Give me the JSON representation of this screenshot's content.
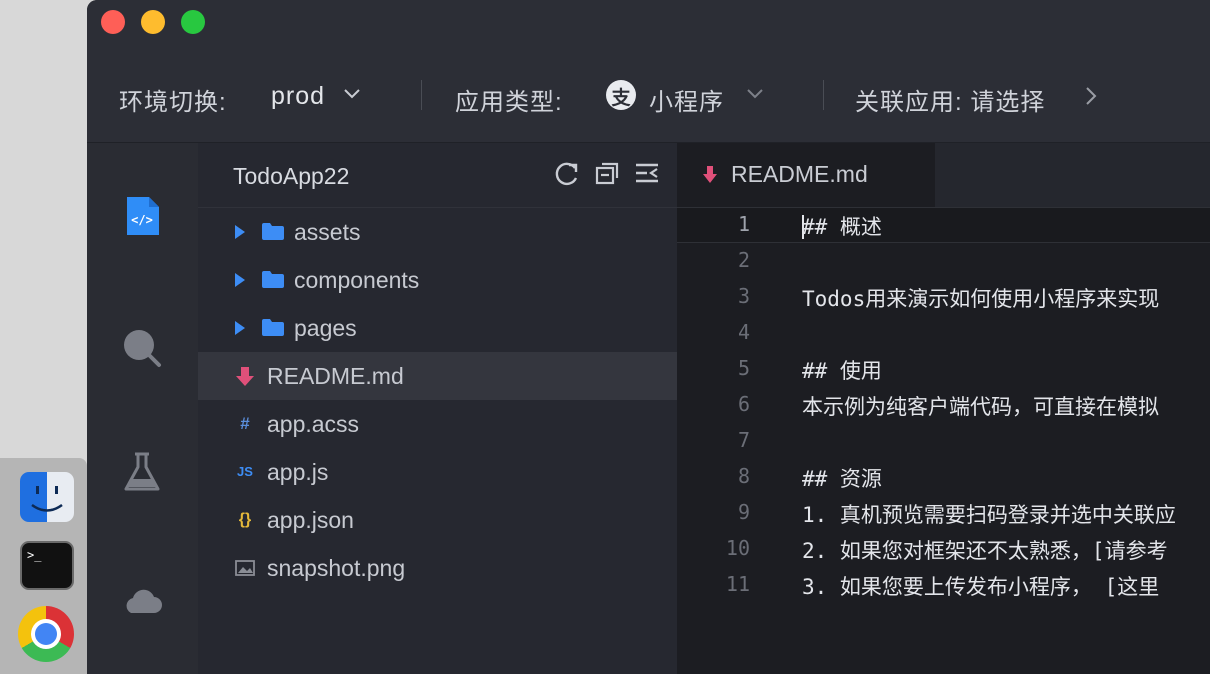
{
  "toolbar": {
    "env_label": "环境切换:",
    "env_value": "prod",
    "app_type_label": "应用类型:",
    "app_type_logo": "支",
    "app_type_value": "小程序",
    "link_label": "关联应用: 请选择"
  },
  "activity_bar": {
    "items": [
      {
        "icon": "code-file-icon",
        "active": true
      },
      {
        "icon": "search-icon",
        "active": false
      },
      {
        "icon": "flask-icon",
        "active": false
      },
      {
        "icon": "cloud-icon",
        "active": false
      }
    ]
  },
  "explorer": {
    "project": "TodoApp22",
    "tools": [
      "refresh-icon",
      "collapse-all-icon",
      "more-icon"
    ],
    "items": [
      {
        "type": "folder",
        "label": "assets"
      },
      {
        "type": "folder",
        "label": "components"
      },
      {
        "type": "folder",
        "label": "pages"
      },
      {
        "type": "markdown",
        "label": "README.md",
        "selected": true
      },
      {
        "type": "acss",
        "label": "app.acss",
        "icon_text": "#"
      },
      {
        "type": "js",
        "label": "app.js",
        "icon_text": "JS"
      },
      {
        "type": "json",
        "label": "app.json",
        "icon_text": "{}"
      },
      {
        "type": "image",
        "label": "snapshot.png"
      }
    ]
  },
  "editor": {
    "tab": {
      "label": "README.md"
    },
    "lines": [
      {
        "n": "1",
        "text": "## 概述"
      },
      {
        "n": "2",
        "text": ""
      },
      {
        "n": "3",
        "text": "Todos用来演示如何使用小程序来实现"
      },
      {
        "n": "4",
        "text": ""
      },
      {
        "n": "5",
        "text": "## 使用"
      },
      {
        "n": "6",
        "text": "本示例为纯客户端代码，可直接在模拟"
      },
      {
        "n": "7",
        "text": ""
      },
      {
        "n": "8",
        "text": "## 资源"
      },
      {
        "n": "9",
        "text": "1. 真机预览需要扫码登录并选中关联应"
      },
      {
        "n": "10",
        "text": "2. 如果您对框架还不太熟悉，[请参考"
      },
      {
        "n": "11",
        "text": "3. 如果您要上传发布小程序，  [这里"
      }
    ]
  },
  "dock": {
    "apps": [
      "finder-icon",
      "terminal-icon",
      "chrome-icon"
    ],
    "terminal_text": ">_"
  },
  "colors": {
    "accent": "#3d8df5",
    "markdown": "#e0507a",
    "json": "#e5b93a",
    "bg": "#262830",
    "editor_bg": "#1c1d22"
  }
}
